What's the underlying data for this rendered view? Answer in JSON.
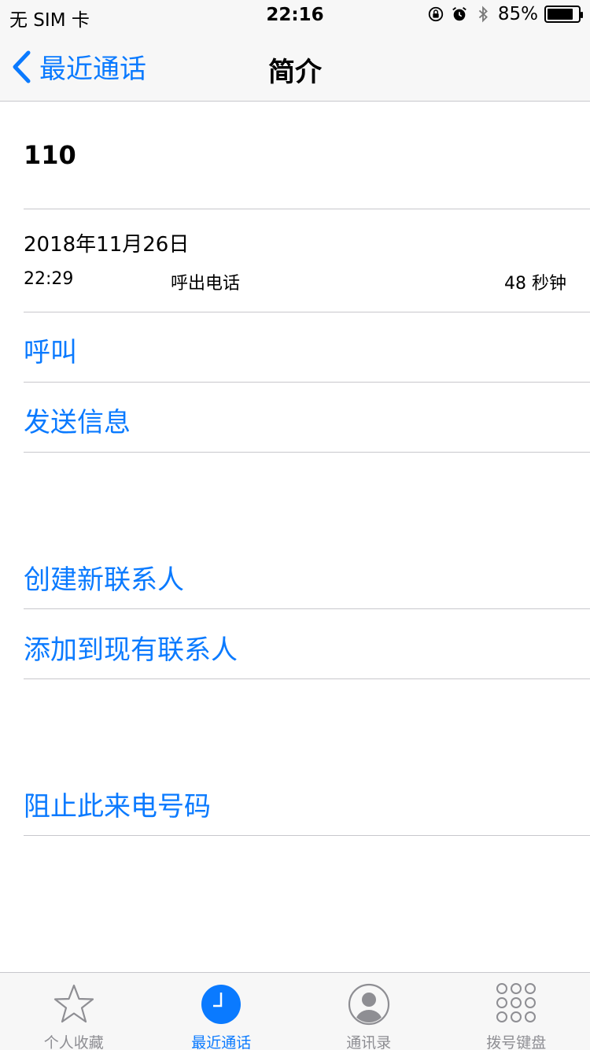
{
  "status_bar": {
    "carrier": "无 SIM 卡",
    "time": "22:16",
    "battery_percent": "85%",
    "battery_level": 0.85,
    "icons": [
      "orientation-lock-icon",
      "alarm-icon",
      "bluetooth-icon",
      "battery-icon"
    ]
  },
  "nav": {
    "back_label": "最近通话",
    "title": "简介"
  },
  "contact": {
    "number": "110"
  },
  "call_log": {
    "date": "2018年11月26日",
    "time": "22:29",
    "type": "呼出电话",
    "duration": "48 秒钟"
  },
  "actions": {
    "call": "呼叫",
    "send_message": "发送信息",
    "create_contact": "创建新联系人",
    "add_to_existing": "添加到现有联系人",
    "block": "阻止此来电号码"
  },
  "tabs": [
    {
      "label": "个人收藏",
      "icon": "star-icon",
      "active": false
    },
    {
      "label": "最近通话",
      "icon": "clock-icon",
      "active": true
    },
    {
      "label": "通讯录",
      "icon": "person-icon",
      "active": false
    },
    {
      "label": "拨号键盘",
      "icon": "keypad-icon",
      "active": false
    }
  ],
  "colors": {
    "accent": "#0a7aff",
    "separator": "#c8c7cc",
    "bar_background": "#f7f7f7",
    "inactive_tab": "#8e8e93"
  }
}
